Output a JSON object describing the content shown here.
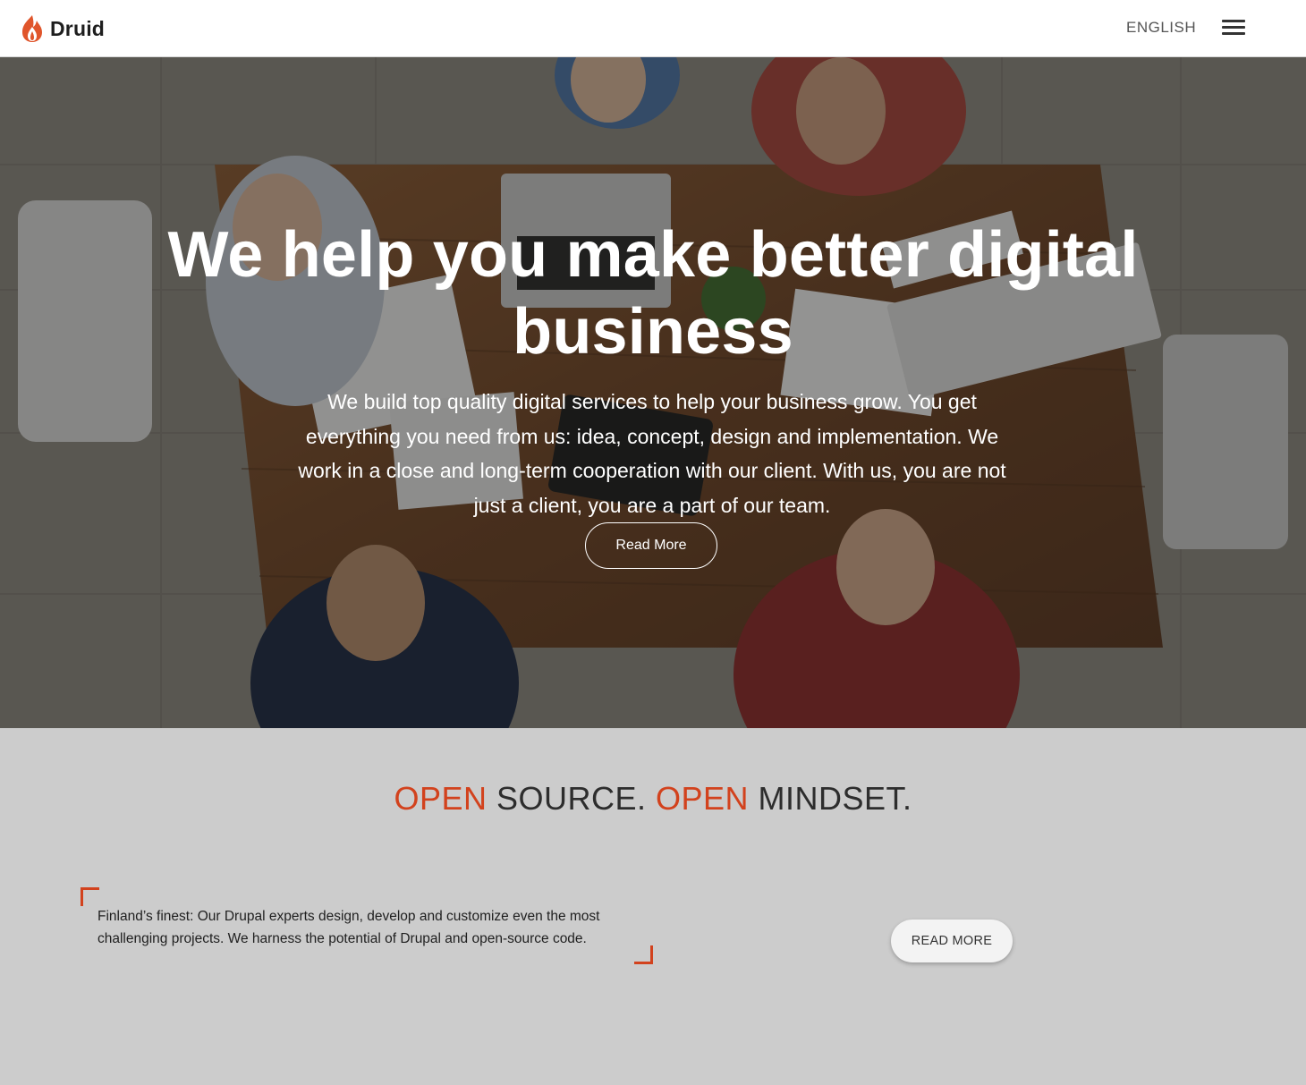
{
  "header": {
    "logo_text": "Druid",
    "language": "ENGLISH",
    "menu_icon": "hamburger-menu-icon"
  },
  "hero": {
    "title": "We help you make better digital business",
    "text": "We build top quality digital services to help your business grow. You get everything you need from us: idea, concept, design and implementation. We work in a close and long-term cooperation with our client. With us, you are not just a client, you are a part of our team.",
    "button_label": "Read More"
  },
  "section": {
    "tagline": {
      "part1": "OPEN",
      "part2": " SOURCE. ",
      "part3": "OPEN",
      "part4": " MINDSET."
    },
    "quote": "Finland’s finest: Our Drupal experts design, develop and customize even the most challenging projects. We harness the potential of Drupal and open-source code.",
    "button_label": "READ MORE"
  },
  "colors": {
    "accent": "#d2421d",
    "section_bg": "#cccccc",
    "header_bg": "#ffffff"
  }
}
